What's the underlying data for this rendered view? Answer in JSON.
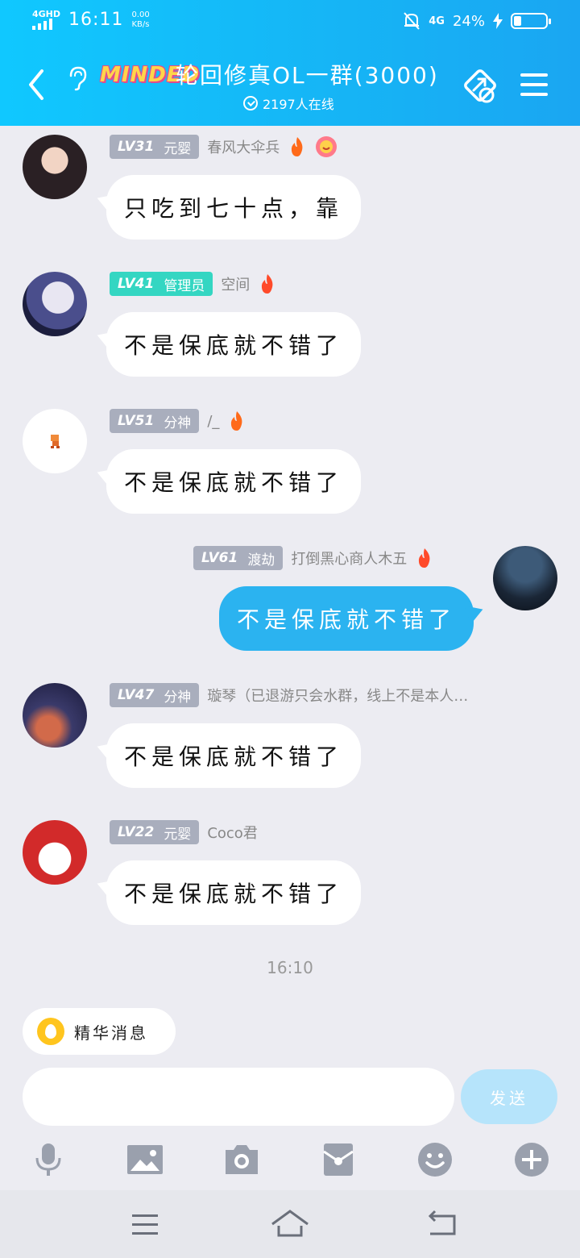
{
  "status_bar": {
    "network_badge": "4GHD",
    "time": "16:11",
    "speed_value": "0.00",
    "speed_unit": "KB/s",
    "signal_label": "4G",
    "battery_pct": "24%",
    "battery_level": 0.24
  },
  "header": {
    "brand": "MINDED",
    "title": "轮回修真OL一群(3000)",
    "online": "2197人在线"
  },
  "messages": [
    {
      "side": "left",
      "level": "LV31",
      "rank": "元婴",
      "nick": "春风大伞兵",
      "text": "只吃到七十点，靠",
      "badge_color": "gray"
    },
    {
      "side": "left",
      "level": "LV41",
      "rank": "管理员",
      "nick": "空间",
      "text": "不是保底就不错了",
      "badge_color": "teal"
    },
    {
      "side": "left",
      "level": "LV51",
      "rank": "分神",
      "nick": "/_",
      "text": "不是保底就不错了",
      "badge_color": "gray"
    },
    {
      "side": "right",
      "level": "LV61",
      "rank": "渡劫",
      "nick": "打倒黑心商人木五",
      "text": "不是保底就不错了",
      "badge_color": "gray"
    },
    {
      "side": "left",
      "level": "LV47",
      "rank": "分神",
      "nick": "璇琴（已退游只会水群，线上不是本人…",
      "text": "不是保底就不错了",
      "badge_color": "gray"
    },
    {
      "side": "left",
      "level": "LV22",
      "rank": "元婴",
      "nick": "Coco君",
      "text": "不是保底就不错了",
      "badge_color": "gray"
    }
  ],
  "timestamp": "16:10",
  "pinned": {
    "label": "精华消息"
  },
  "composer": {
    "placeholder": "",
    "send_label": "发送"
  },
  "toolbar": [
    "mic-icon",
    "image-icon",
    "camera-icon",
    "red-packet-icon",
    "emoji-icon",
    "plus-icon"
  ],
  "colors": {
    "header": "#16b4f5",
    "accent": "#2bb3f0",
    "teal_badge": "#34d6c2",
    "gray_badge": "#a9aebd"
  }
}
